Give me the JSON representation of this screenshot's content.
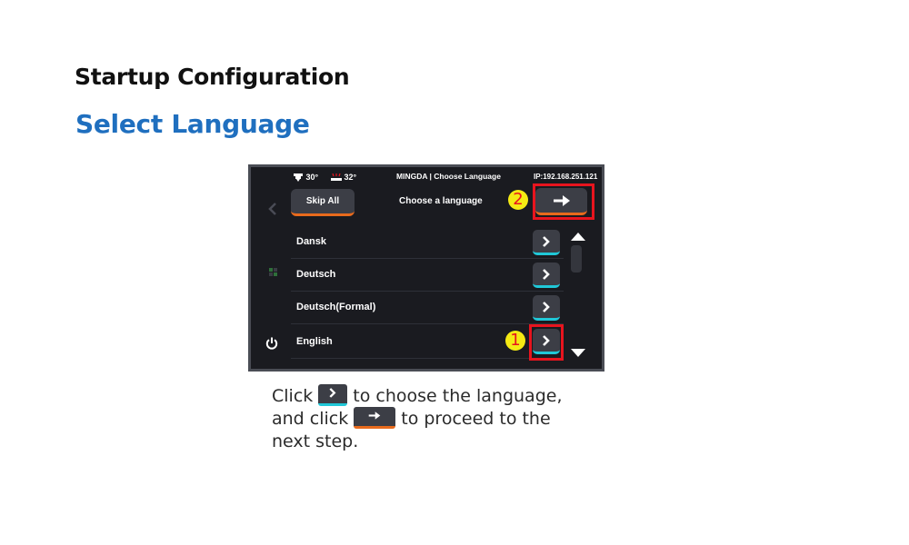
{
  "document": {
    "heading": "Startup Configuration",
    "subheading": "Select Language"
  },
  "device": {
    "status": {
      "nozzle_temp": "30°",
      "bed_temp": "32°",
      "title": "MINGDA | Choose Language",
      "ip": "IP:192.168.251.121"
    },
    "toolbar": {
      "skip_label": "Skip All",
      "choose_label": "Choose a language"
    },
    "languages": [
      "Dansk",
      "Deutsch",
      "Deutsch(Formal)",
      "English"
    ],
    "badges": {
      "step1": "1",
      "step2": "2"
    },
    "icons": {
      "back": "chevron-left-icon",
      "next": "arrow-right-icon",
      "row": "chevron-right-icon",
      "power": "power-icon",
      "nozzle": "nozzle-icon",
      "bed": "bed-icon"
    },
    "colors": {
      "accent_orange": "#e86a1c",
      "accent_cyan": "#20c8d8",
      "highlight_red": "#e8141e",
      "badge_yellow": "#f5ea13"
    }
  },
  "caption": {
    "part1": "Click",
    "part2": "to choose the language,",
    "part3": "and click",
    "part4": "to proceed to the",
    "part5": "next step."
  }
}
